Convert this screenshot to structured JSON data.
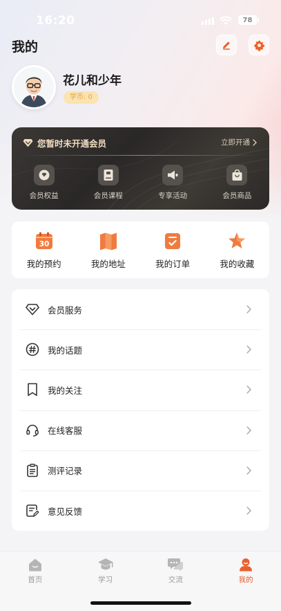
{
  "status_bar": {
    "time": "16:20",
    "battery": "78"
  },
  "header": {
    "title": "我的",
    "edit_icon": "pencil-icon",
    "settings_icon": "gear-icon"
  },
  "profile": {
    "username": "花儿和少年",
    "coin_badge": "学币: 0"
  },
  "vip": {
    "title": "您暂时未开通会员",
    "open_label": "立即开通",
    "accent": "#f0dcc0",
    "items": [
      {
        "label": "会员权益",
        "icon": "vip-rights-icon"
      },
      {
        "label": "会员课程",
        "icon": "vip-course-icon"
      },
      {
        "label": "专享活动",
        "icon": "megaphone-icon"
      },
      {
        "label": "会员商品",
        "icon": "shopping-bag-icon"
      }
    ]
  },
  "shortcuts": [
    {
      "label": "我的预约",
      "icon": "calendar-icon",
      "calendar_number": "30"
    },
    {
      "label": "我的地址",
      "icon": "map-icon"
    },
    {
      "label": "我的订单",
      "icon": "order-icon"
    },
    {
      "label": "我的收藏",
      "icon": "star-icon"
    }
  ],
  "services": [
    {
      "label": "会员服务",
      "icon": "diamond-icon"
    },
    {
      "label": "我的话题",
      "icon": "hashtag-icon"
    },
    {
      "label": "我的关注",
      "icon": "bookmark-icon"
    },
    {
      "label": "在线客服",
      "icon": "headset-icon"
    },
    {
      "label": "测评记录",
      "icon": "clipboard-icon"
    },
    {
      "label": "意见反馈",
      "icon": "feedback-icon"
    }
  ],
  "tabs": [
    {
      "label": "首页",
      "icon": "home-icon",
      "active": false
    },
    {
      "label": "学习",
      "icon": "graduation-cap-icon",
      "active": false
    },
    {
      "label": "交流",
      "icon": "chat-icon",
      "active": false
    },
    {
      "label": "我的",
      "icon": "profile-icon",
      "active": true
    }
  ],
  "colors": {
    "accent": "#e8612c",
    "tab_inactive": "#9a9a9a",
    "vip_gold": "#f0dcc0"
  }
}
